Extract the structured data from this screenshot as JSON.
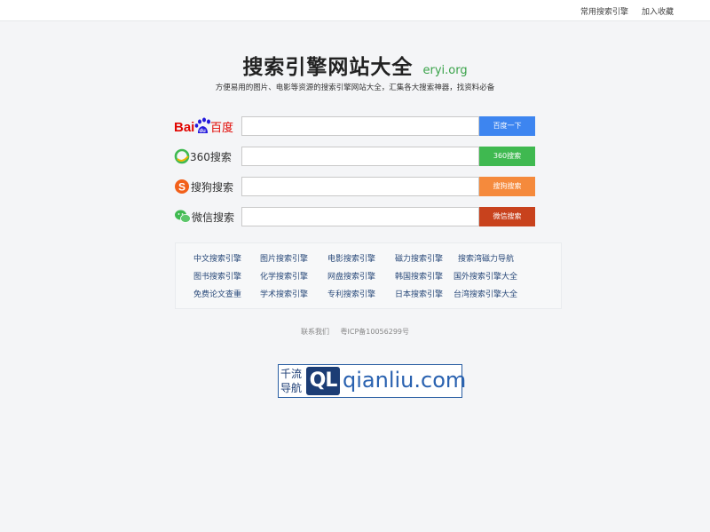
{
  "topbar": {
    "link_common": "常用搜索引擎",
    "link_fav": "加入收藏"
  },
  "header": {
    "title": "搜索引擎网站大全",
    "domain": "eryi.org",
    "subtitle": "方便易用的图片、电影等资源的搜索引擎网站大全，汇集各大搜索神器，找资料必备"
  },
  "engines": [
    {
      "logo_text": "Bai百度",
      "button": "百度一下",
      "color": "#3d85f0",
      "input_value": ""
    },
    {
      "logo_text": "360搜索",
      "button": "360搜索",
      "color": "#3fb950",
      "input_value": ""
    },
    {
      "logo_text": "搜狗搜索",
      "button": "搜狗搜索",
      "color": "#f58a3c",
      "input_value": ""
    },
    {
      "logo_text": "微信搜索",
      "button": "微信搜索",
      "color": "#c8421d",
      "input_value": ""
    }
  ],
  "links": [
    [
      "中文搜索引擎",
      "图片搜索引擎",
      "电影搜索引擎",
      "磁力搜索引擎",
      "搜索湾磁力导航"
    ],
    [
      "图书搜索引擎",
      "化学搜索引擎",
      "网盘搜索引擎",
      "韩国搜索引擎",
      "国外搜索引擎大全"
    ],
    [
      "免费论文查重",
      "学术搜索引擎",
      "专利搜索引擎",
      "日本搜索引擎",
      "台湾搜索引擎大全"
    ]
  ],
  "footer": {
    "contact": "联系我们",
    "icp": "粤ICP备10056299号"
  },
  "banner": {
    "left_text": "千流\n导航",
    "badge": "QL",
    "url": "qianliu.com"
  },
  "colors": {
    "background": "#f4f5f7",
    "title_domain": "#3aa34a",
    "link": "#2a4a7a"
  }
}
